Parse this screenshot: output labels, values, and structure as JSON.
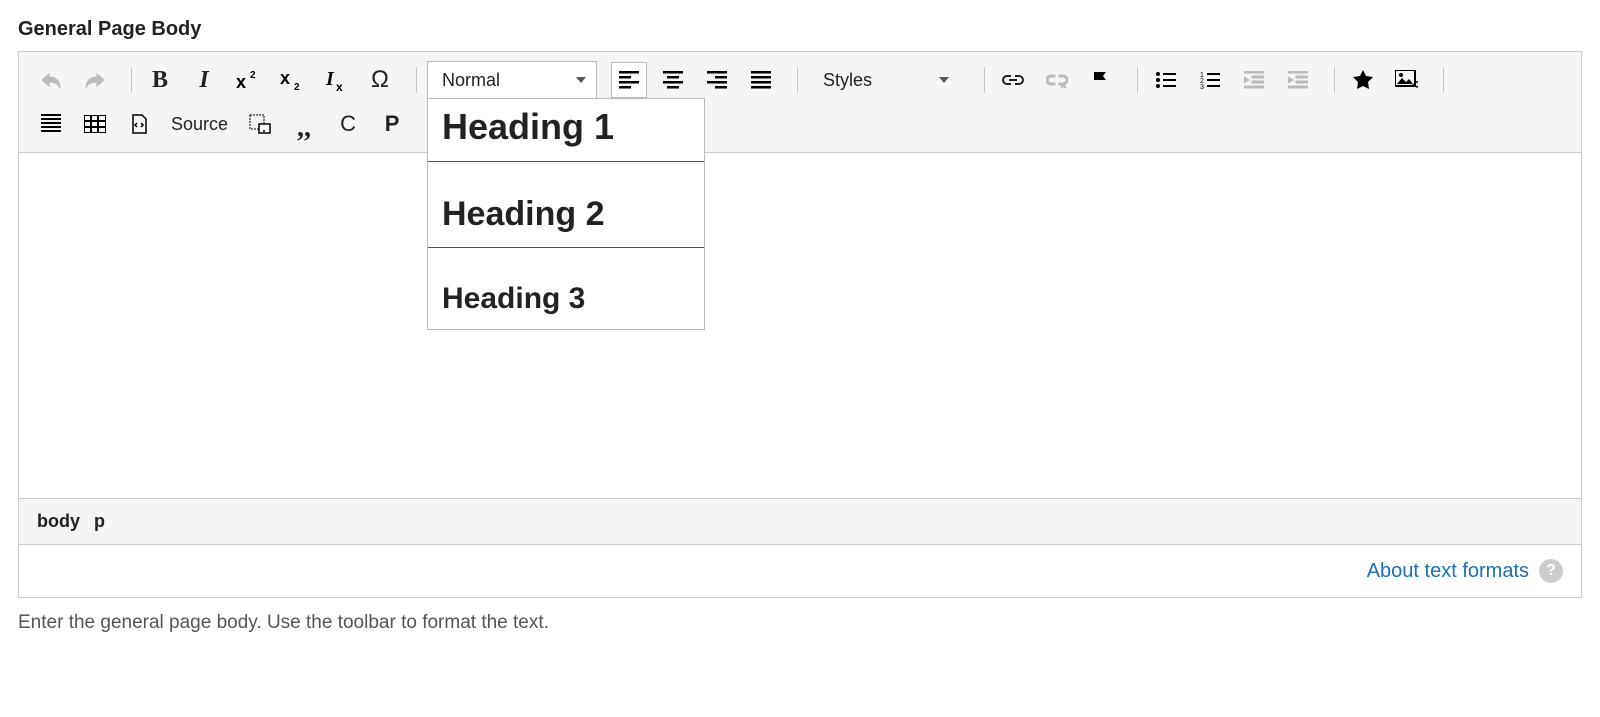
{
  "field_label": "General Page Body",
  "toolbar": {
    "format_dropdown": {
      "selected": "Normal",
      "options": [
        "Heading 1",
        "Heading 2",
        "Heading 3"
      ]
    },
    "styles_dropdown": {
      "selected": "Styles"
    },
    "source_label": "Source"
  },
  "pathbar": {
    "item1": "body",
    "item2": "p"
  },
  "footer": {
    "about_link": "About text formats",
    "help_glyph": "?"
  },
  "hint": "Enter the general page body. Use the toolbar to format the text."
}
